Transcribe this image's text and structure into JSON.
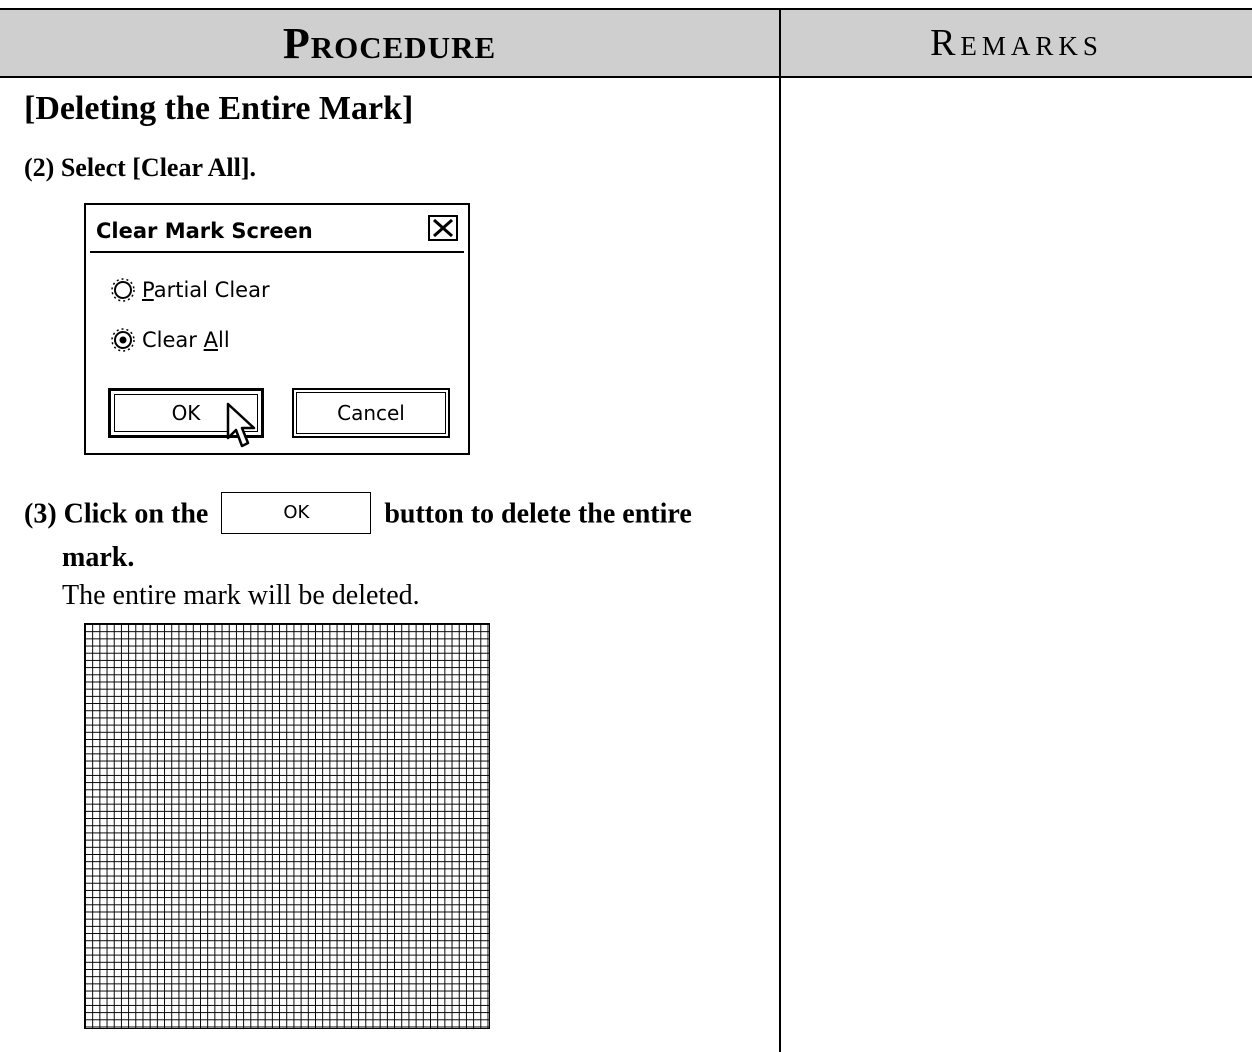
{
  "header": {
    "procedure": "Procedure",
    "remarks": "Remarks"
  },
  "section": {
    "title": "[Deleting the Entire Mark]"
  },
  "steps": {
    "step2": "(2) Select [Clear All].",
    "step3_before": "(3) Click on the",
    "step3_button": "OK",
    "step3_after": "button to delete the entire",
    "step3_cont": "mark.",
    "result": "The entire mark will be deleted."
  },
  "dialog": {
    "title": "Clear Mark Screen",
    "options": [
      {
        "prefix": "",
        "underline": "P",
        "rest": "artial Clear",
        "selected": false
      },
      {
        "prefix": "Clear ",
        "underline": "A",
        "rest": "ll",
        "selected": true
      }
    ],
    "ok_label": "OK",
    "cancel_label": "Cancel"
  },
  "icons": {
    "close": "close-icon",
    "cursor": "mouse-pointer-icon",
    "radio": "radio-button-icon"
  }
}
